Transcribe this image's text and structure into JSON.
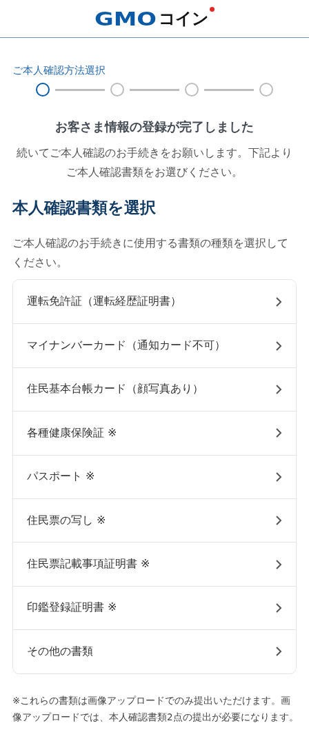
{
  "header": {
    "logo_latin": "GMO",
    "logo_kana": "コイン"
  },
  "progress": {
    "label": "ご本人確認方法選択",
    "steps": [
      {
        "selected": true
      },
      {
        "selected": false
      },
      {
        "selected": false
      },
      {
        "selected": false
      }
    ]
  },
  "completion_title": "お客さま情報の登録が完了しました",
  "completion_text": "続いてご本人確認のお手続きをお願いします。下記よりご本人確認書類をお選びください。",
  "section_title": "本人確認書類を選択",
  "section_text": "ご本人確認のお手続きに使用する書類の種類を選択してください。",
  "documents": [
    {
      "label": "運転免許証（運転経歴証明書）"
    },
    {
      "label": "マイナンバーカード（通知カード不可）"
    },
    {
      "label": "住民基本台帳カード（顔写真あり）"
    },
    {
      "label": "各種健康保険証 ※"
    },
    {
      "label": "パスポート ※"
    },
    {
      "label": "住民票の写し ※"
    },
    {
      "label": "住民票記載事項証明書 ※"
    },
    {
      "label": "印鑑登録証明書 ※"
    },
    {
      "label": "その他の書類"
    }
  ],
  "footnote": "※これらの書類は画像アップロードでのみ提出いただけます。画像アップロードでは、本人確認書類2点の提出が必要になります。"
}
